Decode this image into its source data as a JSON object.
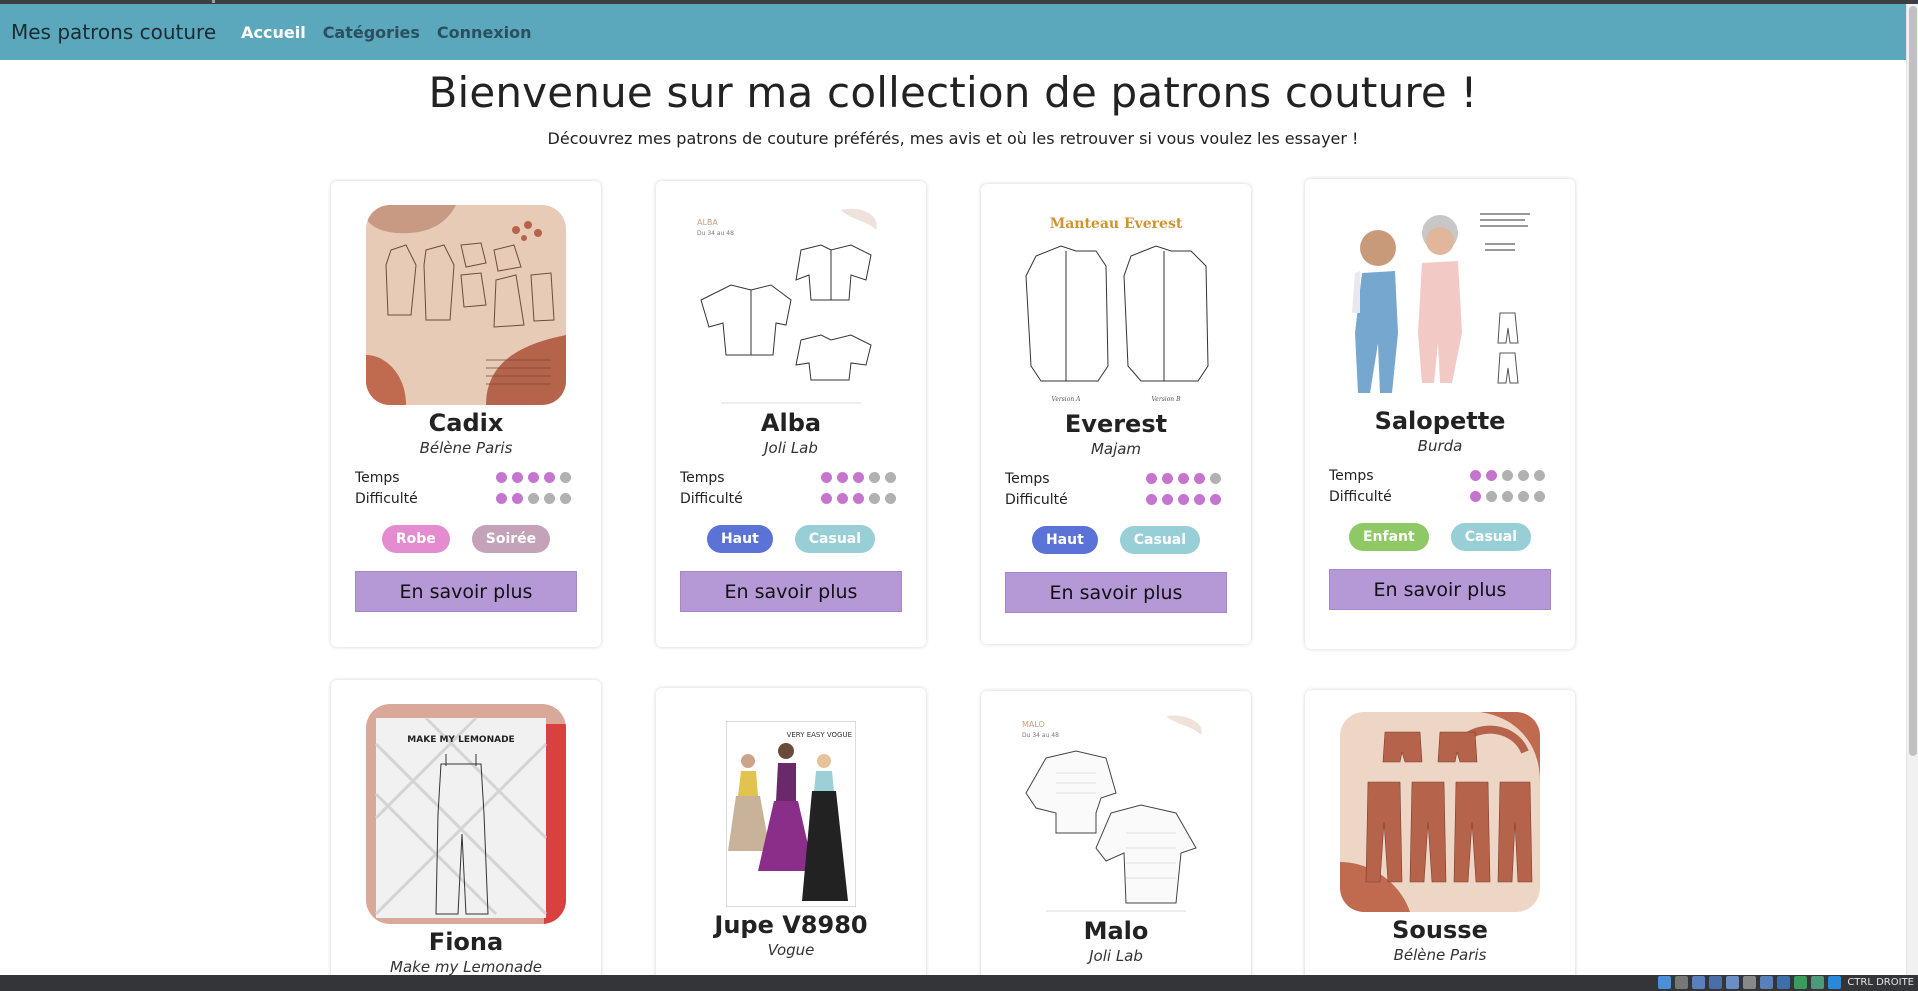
{
  "navbar": {
    "brand": "Mes patrons couture",
    "links": [
      {
        "label": "Accueil",
        "active": true
      },
      {
        "label": "Catégories",
        "active": false
      },
      {
        "label": "Connexion",
        "active": false
      }
    ]
  },
  "hero": {
    "title": "Bienvenue sur ma collection de patrons couture !",
    "subtitle": "Découvrez mes patrons de couture préférés, mes avis et où les retrouver si vous voulez les essayer !"
  },
  "labels": {
    "temps": "Temps",
    "difficulte": "Difficulté",
    "cta": "En savoir plus"
  },
  "colors": {
    "navbar": "#5ba8bd",
    "accent": "#b598d6",
    "dot_on": "#c675cf",
    "dot_off": "#b1b1b1"
  },
  "tag_colors": {
    "Robe": "#e58bd0",
    "Soirée": "#c4a2b8",
    "Haut": "#5b72d6",
    "Casual": "#98cfd7",
    "Enfant": "#8fc965"
  },
  "cards": [
    {
      "title": "Cadix",
      "brand": "Bélène Paris",
      "temps": 4,
      "difficulte": 2,
      "tags": [
        "Robe",
        "Soirée"
      ],
      "image": "cadix-illustration"
    },
    {
      "title": "Alba",
      "brand": "Joli Lab",
      "temps": 3,
      "difficulte": 3,
      "tags": [
        "Haut",
        "Casual"
      ],
      "image": "alba-sketch"
    },
    {
      "title": "Everest",
      "brand": "Majam",
      "temps": 4,
      "difficulte": 5,
      "tags": [
        "Haut",
        "Casual"
      ],
      "image": "everest-coat"
    },
    {
      "title": "Salopette",
      "brand": "Burda",
      "temps": 2,
      "difficulte": 1,
      "tags": [
        "Enfant",
        "Casual"
      ],
      "image": "salopette-kids"
    },
    {
      "title": "Fiona",
      "brand": "Make my Lemonade",
      "image": "fiona-cover"
    },
    {
      "title": "Jupe V8980",
      "brand": "Vogue",
      "image": "vogue-cover"
    },
    {
      "title": "Malo",
      "brand": "Joli Lab",
      "image": "malo-sketch"
    },
    {
      "title": "Sousse",
      "brand": "Bélène Paris",
      "image": "sousse-illustration"
    }
  ],
  "image_text": {
    "alba_header": "ALBA",
    "alba_sizes": "Du 34 au 48",
    "everest_header": "Manteau Everest",
    "everest_caption_a": "Version A",
    "everest_caption_b": "Version B",
    "fiona_header": "MAKE MY LEMONADE",
    "vogue_header": "VERY EASY VOGUE",
    "malo_header": "MALO",
    "malo_sizes": "Du 34 au 48"
  },
  "taskbar": {
    "status": "CTRL DROITE"
  }
}
